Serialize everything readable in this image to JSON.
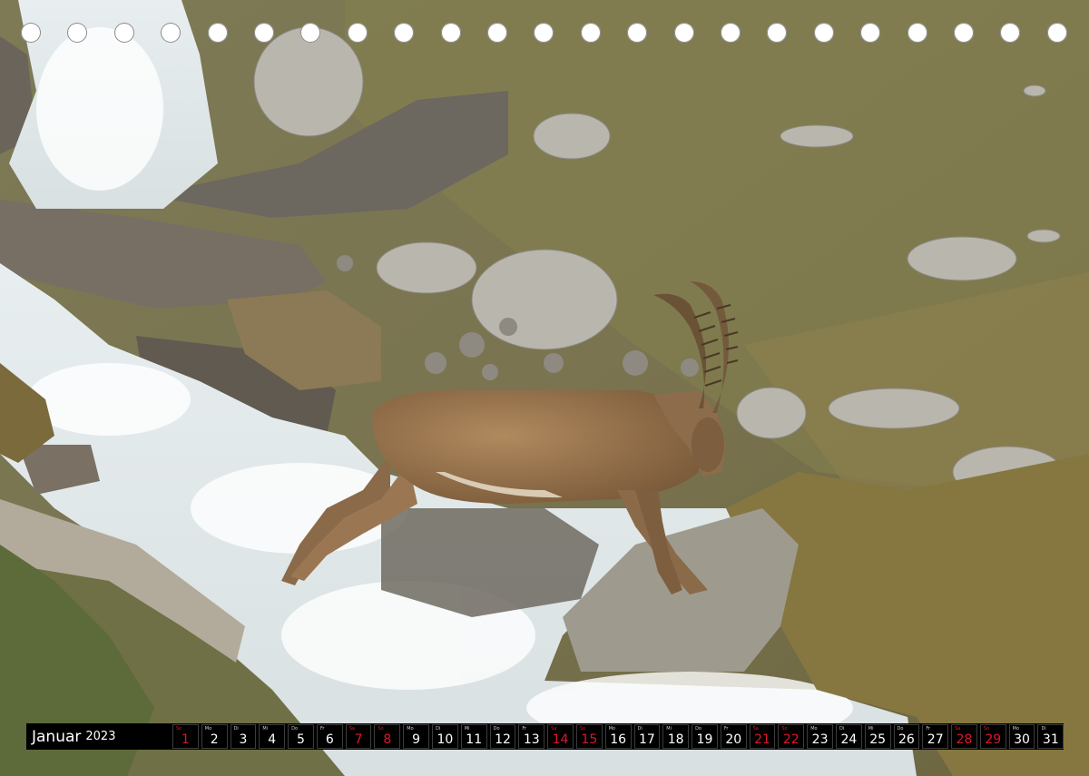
{
  "calendar": {
    "month": "Januar",
    "year": "2023",
    "days": [
      {
        "wd": "So",
        "n": "1",
        "weekend": true
      },
      {
        "wd": "Mo",
        "n": "2",
        "weekend": false
      },
      {
        "wd": "Di",
        "n": "3",
        "weekend": false
      },
      {
        "wd": "Mi",
        "n": "4",
        "weekend": false
      },
      {
        "wd": "Do",
        "n": "5",
        "weekend": false
      },
      {
        "wd": "Fr",
        "n": "6",
        "weekend": false
      },
      {
        "wd": "Sa",
        "n": "7",
        "weekend": true
      },
      {
        "wd": "So",
        "n": "8",
        "weekend": true
      },
      {
        "wd": "Mo",
        "n": "9",
        "weekend": false
      },
      {
        "wd": "Di",
        "n": "10",
        "weekend": false
      },
      {
        "wd": "Mi",
        "n": "11",
        "weekend": false
      },
      {
        "wd": "Do",
        "n": "12",
        "weekend": false
      },
      {
        "wd": "Fr",
        "n": "13",
        "weekend": false
      },
      {
        "wd": "Sa",
        "n": "14",
        "weekend": true
      },
      {
        "wd": "So",
        "n": "15",
        "weekend": true
      },
      {
        "wd": "Mo",
        "n": "16",
        "weekend": false
      },
      {
        "wd": "Di",
        "n": "17",
        "weekend": false
      },
      {
        "wd": "Mi",
        "n": "18",
        "weekend": false
      },
      {
        "wd": "Do",
        "n": "19",
        "weekend": false
      },
      {
        "wd": "Fr",
        "n": "20",
        "weekend": false
      },
      {
        "wd": "Sa",
        "n": "21",
        "weekend": true
      },
      {
        "wd": "So",
        "n": "22",
        "weekend": true
      },
      {
        "wd": "Mo",
        "n": "23",
        "weekend": false
      },
      {
        "wd": "Di",
        "n": "24",
        "weekend": false
      },
      {
        "wd": "Mi",
        "n": "25",
        "weekend": false
      },
      {
        "wd": "Do",
        "n": "26",
        "weekend": false
      },
      {
        "wd": "Fr",
        "n": "27",
        "weekend": false
      },
      {
        "wd": "Sa",
        "n": "28",
        "weekend": true
      },
      {
        "wd": "So",
        "n": "29",
        "weekend": true
      },
      {
        "wd": "Mo",
        "n": "30",
        "weekend": false
      },
      {
        "wd": "Di",
        "n": "31",
        "weekend": false
      }
    ]
  },
  "colors": {
    "weekend": "#e0162b",
    "weekday": "#ffffff",
    "bar": "#000000"
  },
  "binding_holes": 23
}
